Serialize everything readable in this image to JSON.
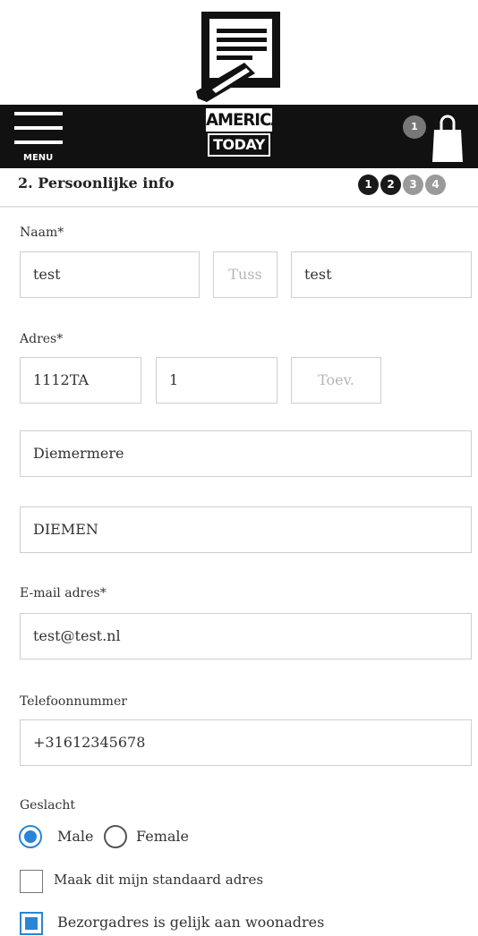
{
  "header": {
    "menu_label": "MENU",
    "logo_top": "AMERICA",
    "logo_bottom": "TODAY",
    "cart_count": "1"
  },
  "steps": {
    "title": "2. Persoonlijke info",
    "items": [
      "1",
      "2",
      "3",
      "4"
    ],
    "current": 2
  },
  "form": {
    "name": {
      "label": "Naam*",
      "first": "test",
      "middle_placeholder": "Tuss",
      "last": "test"
    },
    "address": {
      "label": "Adres*",
      "postcode": "1112TA",
      "number": "1",
      "addition_placeholder": "Toev.",
      "street": "Diemermere",
      "city": "DIEMEN"
    },
    "email": {
      "label": "E-mail adres*",
      "value": "test@test.nl"
    },
    "phone": {
      "label": "Telefoonnummer",
      "value": "+31612345678"
    },
    "gender": {
      "label": "Geslacht",
      "options": [
        "Male",
        "Female"
      ],
      "selected": "Male"
    },
    "default_address": {
      "label": "Maak dit mijn standaard adres",
      "checked": false
    },
    "same_delivery": {
      "label": "Bezorgadres is gelijk aan woonadres",
      "checked": true
    }
  },
  "colors": {
    "accent": "#2a85d6",
    "header_bg": "#111111"
  }
}
